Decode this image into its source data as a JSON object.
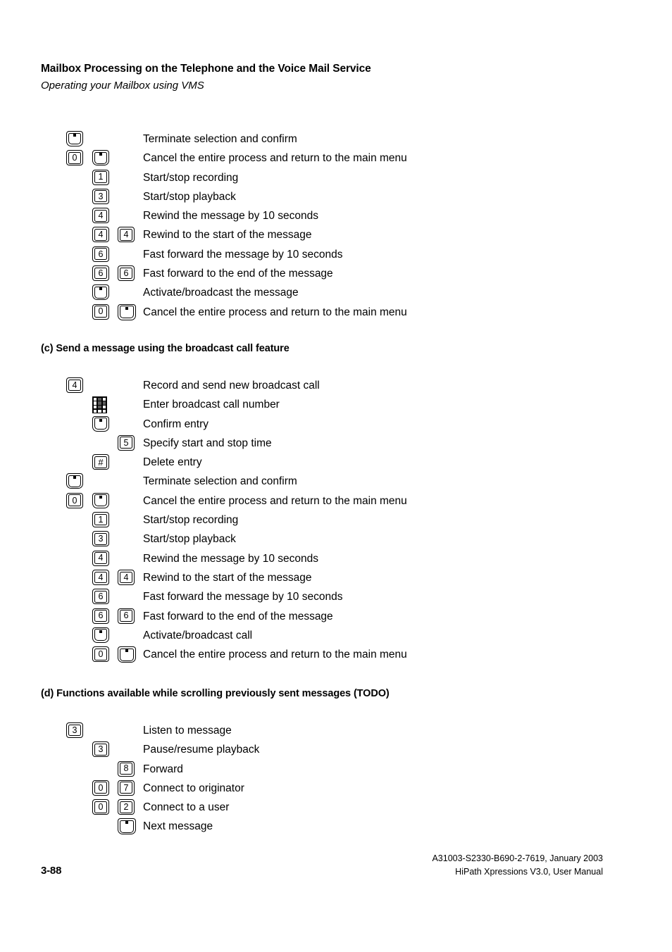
{
  "header": {
    "title": "Mailbox Processing on the Telephone and the Voice Mail Service",
    "subtitle": "Operating your Mailbox using VMS"
  },
  "sections": {
    "a": {
      "rows": [
        {
          "keys": [
            {
              "slot": 0,
              "type": "star",
              "glyph": "*"
            }
          ],
          "label": "Terminate selection and confirm"
        },
        {
          "keys": [
            {
              "slot": 0,
              "type": "digit",
              "glyph": "0"
            },
            {
              "slot": 1,
              "type": "star",
              "glyph": "*"
            }
          ],
          "label": "Cancel the entire process and return to the main menu"
        },
        {
          "keys": [
            {
              "slot": 1,
              "type": "digit",
              "glyph": "1"
            }
          ],
          "label": "Start/stop recording"
        },
        {
          "keys": [
            {
              "slot": 1,
              "type": "digit",
              "glyph": "3"
            }
          ],
          "label": "Start/stop playback"
        },
        {
          "keys": [
            {
              "slot": 1,
              "type": "digit",
              "glyph": "4"
            }
          ],
          "label": "Rewind the message by 10 seconds"
        },
        {
          "keys": [
            {
              "slot": 1,
              "type": "digit",
              "glyph": "4"
            },
            {
              "slot": 2,
              "type": "digit",
              "glyph": "4"
            }
          ],
          "label": "Rewind to the start of the message"
        },
        {
          "keys": [
            {
              "slot": 1,
              "type": "digit",
              "glyph": "6"
            }
          ],
          "label": "Fast forward the message by 10 seconds"
        },
        {
          "keys": [
            {
              "slot": 1,
              "type": "digit",
              "glyph": "6"
            },
            {
              "slot": 2,
              "type": "digit",
              "glyph": "6"
            }
          ],
          "label": "Fast forward to the end of the message"
        },
        {
          "keys": [
            {
              "slot": 1,
              "type": "star",
              "glyph": "*"
            }
          ],
          "label": "Activate/broadcast the message"
        },
        {
          "keys": [
            {
              "slot": 1,
              "type": "digit",
              "glyph": "0"
            },
            {
              "slot": 2,
              "type": "star-lg",
              "glyph": "*"
            }
          ],
          "label": "Cancel the entire process and return to the main menu"
        }
      ]
    },
    "c": {
      "heading": "(c) Send a message using the broadcast call feature",
      "rows": [
        {
          "keys": [
            {
              "slot": 0,
              "type": "digit",
              "glyph": "4"
            }
          ],
          "label": "Record and send new broadcast call"
        },
        {
          "keys": [
            {
              "slot": 1,
              "type": "dialpad",
              "glyph": ""
            }
          ],
          "label": "Enter broadcast call number"
        },
        {
          "keys": [
            {
              "slot": 1,
              "type": "star",
              "glyph": "*"
            }
          ],
          "label": "Confirm entry"
        },
        {
          "keys": [
            {
              "slot": 2,
              "type": "digit",
              "glyph": "5"
            }
          ],
          "label": "Specify start and stop time"
        },
        {
          "keys": [
            {
              "slot": 1,
              "type": "hash",
              "glyph": "#"
            }
          ],
          "label": "Delete entry"
        },
        {
          "keys": [
            {
              "slot": 0,
              "type": "star",
              "glyph": "*"
            }
          ],
          "label": "Terminate selection and confirm"
        },
        {
          "keys": [
            {
              "slot": 0,
              "type": "digit",
              "glyph": "0"
            },
            {
              "slot": 1,
              "type": "star",
              "glyph": "*"
            }
          ],
          "label": "Cancel the entire process and return to the main menu"
        },
        {
          "keys": [
            {
              "slot": 1,
              "type": "digit",
              "glyph": "1"
            }
          ],
          "label": "Start/stop recording"
        },
        {
          "keys": [
            {
              "slot": 1,
              "type": "digit",
              "glyph": "3"
            }
          ],
          "label": "Start/stop playback"
        },
        {
          "keys": [
            {
              "slot": 1,
              "type": "digit",
              "glyph": "4"
            }
          ],
          "label": "Rewind the message by 10 seconds"
        },
        {
          "keys": [
            {
              "slot": 1,
              "type": "digit",
              "glyph": "4"
            },
            {
              "slot": 2,
              "type": "digit",
              "glyph": "4"
            }
          ],
          "label": "Rewind to the start of the message"
        },
        {
          "keys": [
            {
              "slot": 1,
              "type": "digit",
              "glyph": "6"
            }
          ],
          "label": "Fast forward the message by 10 seconds"
        },
        {
          "keys": [
            {
              "slot": 1,
              "type": "digit",
              "glyph": "6"
            },
            {
              "slot": 2,
              "type": "digit",
              "glyph": "6"
            }
          ],
          "label": "Fast forward to the end of the message"
        },
        {
          "keys": [
            {
              "slot": 1,
              "type": "star",
              "glyph": "*"
            }
          ],
          "label": "Activate/broadcast call"
        },
        {
          "keys": [
            {
              "slot": 1,
              "type": "digit",
              "glyph": "0"
            },
            {
              "slot": 2,
              "type": "star-lg",
              "glyph": "*"
            }
          ],
          "label": "Cancel the entire process and return to the main menu"
        }
      ]
    },
    "d": {
      "heading": "(d) Functions available while scrolling previously sent messages (TODO)",
      "rows": [
        {
          "keys": [
            {
              "slot": 0,
              "type": "digit",
              "glyph": "3"
            }
          ],
          "label": "Listen to message"
        },
        {
          "keys": [
            {
              "slot": 1,
              "type": "digit",
              "glyph": "3"
            }
          ],
          "label": "Pause/resume playback"
        },
        {
          "keys": [
            {
              "slot": 2,
              "type": "digit",
              "glyph": "8"
            }
          ],
          "label": "Forward"
        },
        {
          "keys": [
            {
              "slot": 1,
              "type": "digit",
              "glyph": "0"
            },
            {
              "slot": 2,
              "type": "digit",
              "glyph": "7"
            }
          ],
          "label": "Connect to originator"
        },
        {
          "keys": [
            {
              "slot": 1,
              "type": "digit",
              "glyph": "0"
            },
            {
              "slot": 2,
              "type": "digit",
              "glyph": "2"
            }
          ],
          "label": "Connect to a user"
        },
        {
          "keys": [
            {
              "slot": 2,
              "type": "star-lg",
              "glyph": "*"
            }
          ],
          "label": "Next message"
        }
      ]
    }
  },
  "footer": {
    "page_number": "3-88",
    "doc_id": "A31003-S2330-B690-2-7619, January 2003",
    "manual": "HiPath Xpressions V3.0, User Manual"
  }
}
